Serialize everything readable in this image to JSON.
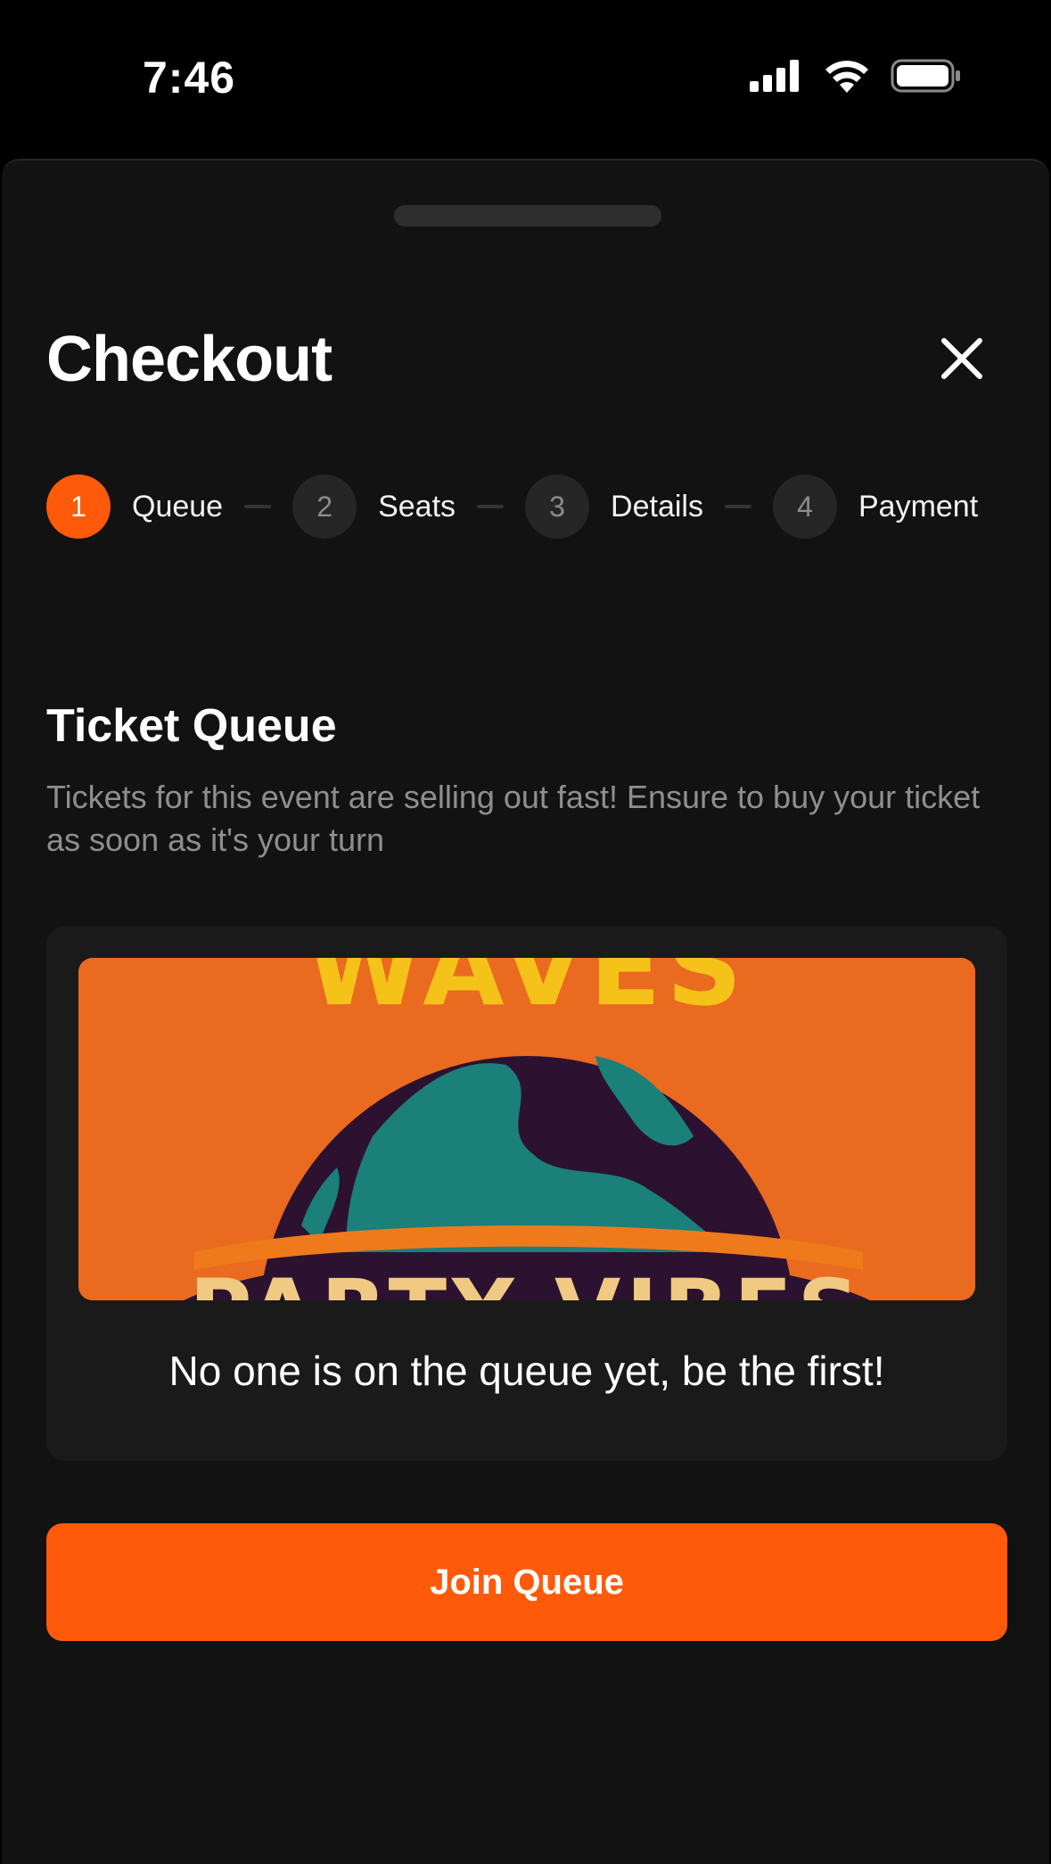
{
  "status_bar": {
    "time": "7:46"
  },
  "header": {
    "title": "Checkout"
  },
  "steps": [
    {
      "number": "1",
      "label": "Queue",
      "active": true
    },
    {
      "number": "2",
      "label": "Seats",
      "active": false
    },
    {
      "number": "3",
      "label": "Details",
      "active": false
    },
    {
      "number": "4",
      "label": "Payment",
      "active": false
    }
  ],
  "section": {
    "title": "Ticket Queue",
    "description": "Tickets for this event are selling out fast! Ensure to buy your ticket as soon as it's your turn"
  },
  "card": {
    "banner_top_text": "WAVES",
    "banner_bottom_text": "PARTY VIBES",
    "message": "No one is on the queue yet, be the first!"
  },
  "actions": {
    "join_label": "Join Queue"
  },
  "colors": {
    "accent": "#ff5a0a",
    "background": "#121212",
    "card": "#1a1a1a"
  },
  "icons": [
    "cellular-signal-icon",
    "wifi-icon",
    "battery-icon",
    "close-icon"
  ]
}
